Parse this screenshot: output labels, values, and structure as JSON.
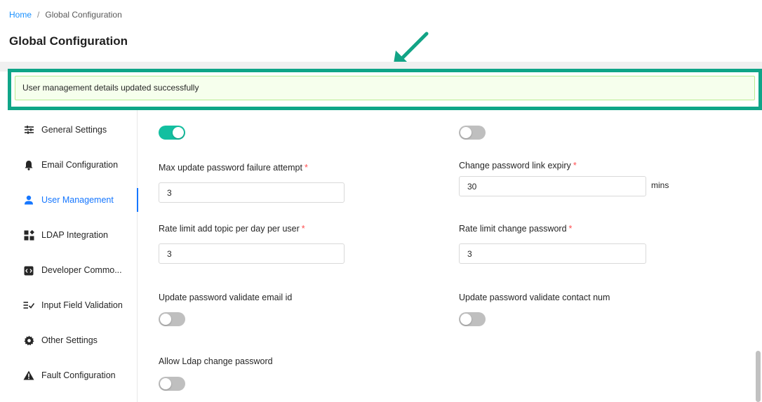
{
  "breadcrumb": {
    "home": "Home",
    "separator": "/",
    "current": "Global Configuration"
  },
  "page_title": "Global Configuration",
  "alert": {
    "message": "User management details updated successfully"
  },
  "colors": {
    "accent": "#1677ff",
    "toggle_on": "#13bfa0",
    "highlight_frame": "#0fa588",
    "alert_bg": "#f6ffed"
  },
  "sidebar": {
    "items": [
      {
        "label": "General Settings",
        "icon": "sliders-icon"
      },
      {
        "label": "Email Configuration",
        "icon": "bell-icon"
      },
      {
        "label": "User Management",
        "icon": "user-icon",
        "active": true
      },
      {
        "label": "LDAP Integration",
        "icon": "blocks-icon"
      },
      {
        "label": "Developer Commo...",
        "icon": "code-icon"
      },
      {
        "label": "Input Field Validation",
        "icon": "checklist-icon"
      },
      {
        "label": "Other Settings",
        "icon": "gear-icon"
      },
      {
        "label": "Fault Configuration",
        "icon": "warning-icon"
      }
    ]
  },
  "form": {
    "top_toggle_left": true,
    "top_toggle_right": false,
    "max_update_password_failure_attempt": {
      "label": "Max update password failure attempt",
      "required": "*",
      "value": "3"
    },
    "change_password_link_expiry": {
      "label": "Change password link expiry",
      "required": "*",
      "value": "30",
      "suffix": "mins"
    },
    "rate_limit_add_topic": {
      "label": "Rate limit add topic per day per user",
      "required": "*",
      "value": "3"
    },
    "rate_limit_change_password": {
      "label": "Rate limit change password",
      "required": "*",
      "value": "3"
    },
    "update_password_validate_email": {
      "label": "Update password validate email id",
      "enabled": false
    },
    "update_password_validate_contact": {
      "label": "Update password validate contact num",
      "enabled": false
    },
    "allow_ldap_change_password": {
      "label": "Allow Ldap change password",
      "enabled": false
    }
  }
}
